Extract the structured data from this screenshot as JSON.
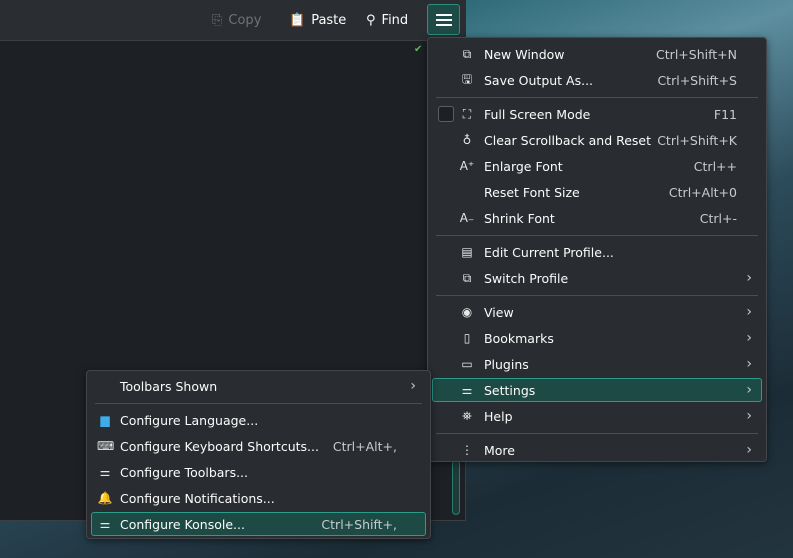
{
  "toolbar": {
    "copy": "Copy",
    "paste": "Paste",
    "find": "Find"
  },
  "main_menu": [
    {
      "type": "item",
      "icon": "new-window-icon",
      "glyph": "⧉",
      "label": "New Window",
      "shortcut": "Ctrl+Shift+N"
    },
    {
      "type": "item",
      "icon": "save-icon",
      "glyph": "🖫",
      "label": "Save Output As...",
      "shortcut": "Ctrl+Shift+S"
    },
    {
      "type": "sep"
    },
    {
      "type": "item",
      "checkbox": true,
      "icon": "fullscreen-icon",
      "glyph": "⛶",
      "label": "Full Screen Mode",
      "shortcut": "F11"
    },
    {
      "type": "item",
      "icon": "clear-icon",
      "glyph": "♁",
      "label": "Clear Scrollback and Reset",
      "shortcut": "Ctrl+Shift+K"
    },
    {
      "type": "item",
      "icon": "enlarge-font-icon",
      "glyph": "A⁺",
      "label": "Enlarge Font",
      "shortcut": "Ctrl++"
    },
    {
      "type": "item",
      "label": "Reset Font Size",
      "shortcut": "Ctrl+Alt+0"
    },
    {
      "type": "item",
      "icon": "shrink-font-icon",
      "glyph": "A₋",
      "label": "Shrink Font",
      "shortcut": "Ctrl+-"
    },
    {
      "type": "sep"
    },
    {
      "type": "item",
      "icon": "edit-profile-icon",
      "glyph": "▤",
      "label": "Edit Current Profile..."
    },
    {
      "type": "item",
      "icon": "switch-profile-icon",
      "glyph": "⧉",
      "label": "Switch Profile",
      "submenu": true
    },
    {
      "type": "sep"
    },
    {
      "type": "item",
      "icon": "eye-icon",
      "glyph": "◉",
      "label": "View",
      "submenu": true
    },
    {
      "type": "item",
      "icon": "bookmark-icon",
      "glyph": "▯",
      "label": "Bookmarks",
      "submenu": true
    },
    {
      "type": "item",
      "icon": "plugins-icon",
      "glyph": "▭",
      "label": "Plugins",
      "submenu": true
    },
    {
      "type": "item",
      "icon": "settings-icon",
      "glyph": "⚌",
      "label": "Settings",
      "submenu": true,
      "highlighted": true
    },
    {
      "type": "item",
      "icon": "help-icon",
      "glyph": "⛯",
      "label": "Help",
      "submenu": true
    },
    {
      "type": "sep"
    },
    {
      "type": "item",
      "icon": "more-icon",
      "glyph": "⋮",
      "label": "More",
      "submenu": true
    }
  ],
  "settings_menu": [
    {
      "type": "item",
      "label": "Toolbars Shown",
      "submenu": true
    },
    {
      "type": "sep"
    },
    {
      "type": "item",
      "icon": "language-icon",
      "glyph": "▆",
      "color": "#3daee9",
      "label": "Configure Language..."
    },
    {
      "type": "item",
      "icon": "keyboard-icon",
      "glyph": "⌨",
      "label": "Configure Keyboard Shortcuts...",
      "shortcut": "Ctrl+Alt+,"
    },
    {
      "type": "item",
      "icon": "toolbars-icon",
      "glyph": "⚌",
      "label": "Configure Toolbars..."
    },
    {
      "type": "item",
      "icon": "bell-icon",
      "glyph": "🔔",
      "color": "#f6a623",
      "label": "Configure Notifications..."
    },
    {
      "type": "item",
      "icon": "configure-icon",
      "glyph": "⚌",
      "label": "Configure Konsole...",
      "shortcut": "Ctrl+Shift+,",
      "highlighted": true
    }
  ]
}
